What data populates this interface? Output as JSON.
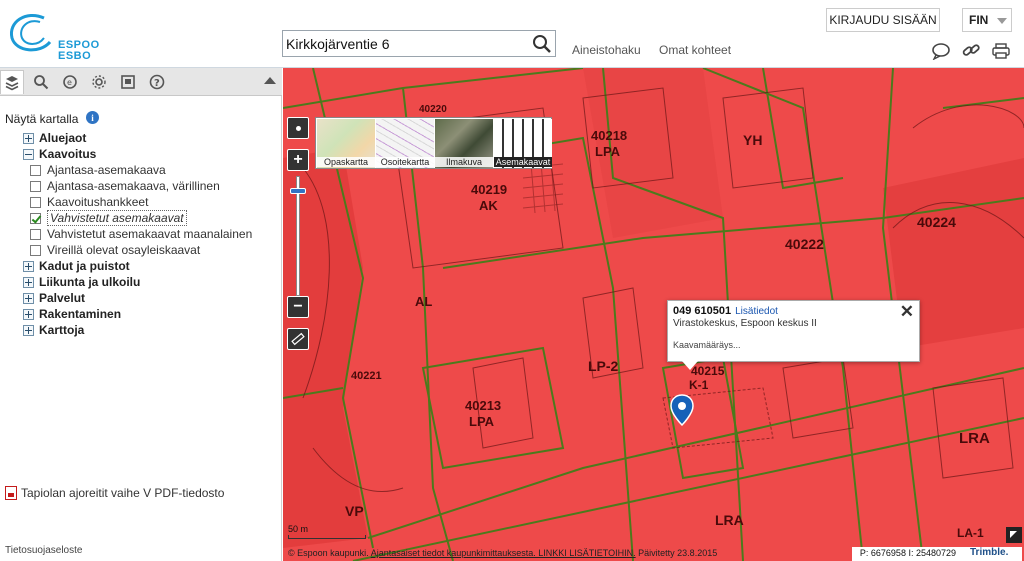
{
  "header": {
    "logo_line1": "ESPOO",
    "logo_line2": "ESBO",
    "search_value": "Kirkkojärventie 6",
    "link_data": "Aineistohaku",
    "link_own": "Omat kohteet",
    "login_label": "KIRJAUDU SISÄÄN",
    "language": "FIN",
    "brand_color": "#1c9ad6"
  },
  "left_panel": {
    "tabs": [
      "layers-icon",
      "search-icon",
      "measure-icon",
      "settings-icon",
      "print-preview-icon",
      "help-icon"
    ],
    "legend_title": "Näytä kartalla",
    "tree": {
      "aluejaot": "Aluejaot",
      "kaavoitus": "Kaavoitus",
      "kaavoitus_items": [
        {
          "label": "Ajantasa-asemakaava",
          "checked": false
        },
        {
          "label": "Ajantasa-asemakaava, värillinen",
          "checked": false
        },
        {
          "label": "Kaavoitushankkeet",
          "checked": false
        },
        {
          "label": "Vahvistetut asemakaavat",
          "checked": true
        },
        {
          "label": "Vahvistetut asemakaavat maanalainen",
          "checked": false
        },
        {
          "label": "Vireillä olevat osayleiskaavat",
          "checked": false
        }
      ],
      "kadut": "Kadut ja puistot",
      "liikunta": "Liikunta ja ulkoilu",
      "palvelut": "Palvelut",
      "rakentaminen": "Rakentaminen",
      "karttoja": "Karttoja"
    },
    "pdf_link": "Tapiolan ajoreitit vaihe V PDF-tiedosto",
    "privacy": "Tietosuojaseloste"
  },
  "map": {
    "basemaps": [
      {
        "label": "Opaskartta",
        "active": false
      },
      {
        "label": "Osoitekartta",
        "active": false
      },
      {
        "label": "Ilmakuva",
        "active": false
      },
      {
        "label": "Asemakaavat",
        "active": true
      }
    ],
    "popup": {
      "id": "049 610501",
      "link": "Lisätiedot",
      "subtitle": "Virastokeskus, Espoon keskus II",
      "note": "Kaavamääräys..."
    },
    "labels": {
      "l40220": "40220",
      "l40218": "40218",
      "l40219": "40219",
      "l40221": "40221",
      "l40213": "40213",
      "l40215": "40215",
      "l40224": "40224",
      "l40222": "40222",
      "ak": "AK",
      "lpa": "LPA",
      "al": "AL",
      "yh": "YH",
      "vp": "VP",
      "lra": "LRA",
      "lp2": "LP-2",
      "k1": "K-1",
      "la1": "LA-1",
      "lpa2": "LPA",
      "lra2": "LRA"
    },
    "scale_label": "50 m",
    "copyright_a": "© Espoon kaupunki. ",
    "copyright_b": "Ajantasaiset tiedot kaupunkimittauksesta. LINKKI LISÄTIETOIHIN.",
    "copyright_c": " Päivitetty 23.8.2015",
    "coords": "P: 6676958 I: 25480729",
    "trimble": "Trimble.",
    "plan_color": "#ee4a4a",
    "line_color": "#4c7a1c"
  }
}
